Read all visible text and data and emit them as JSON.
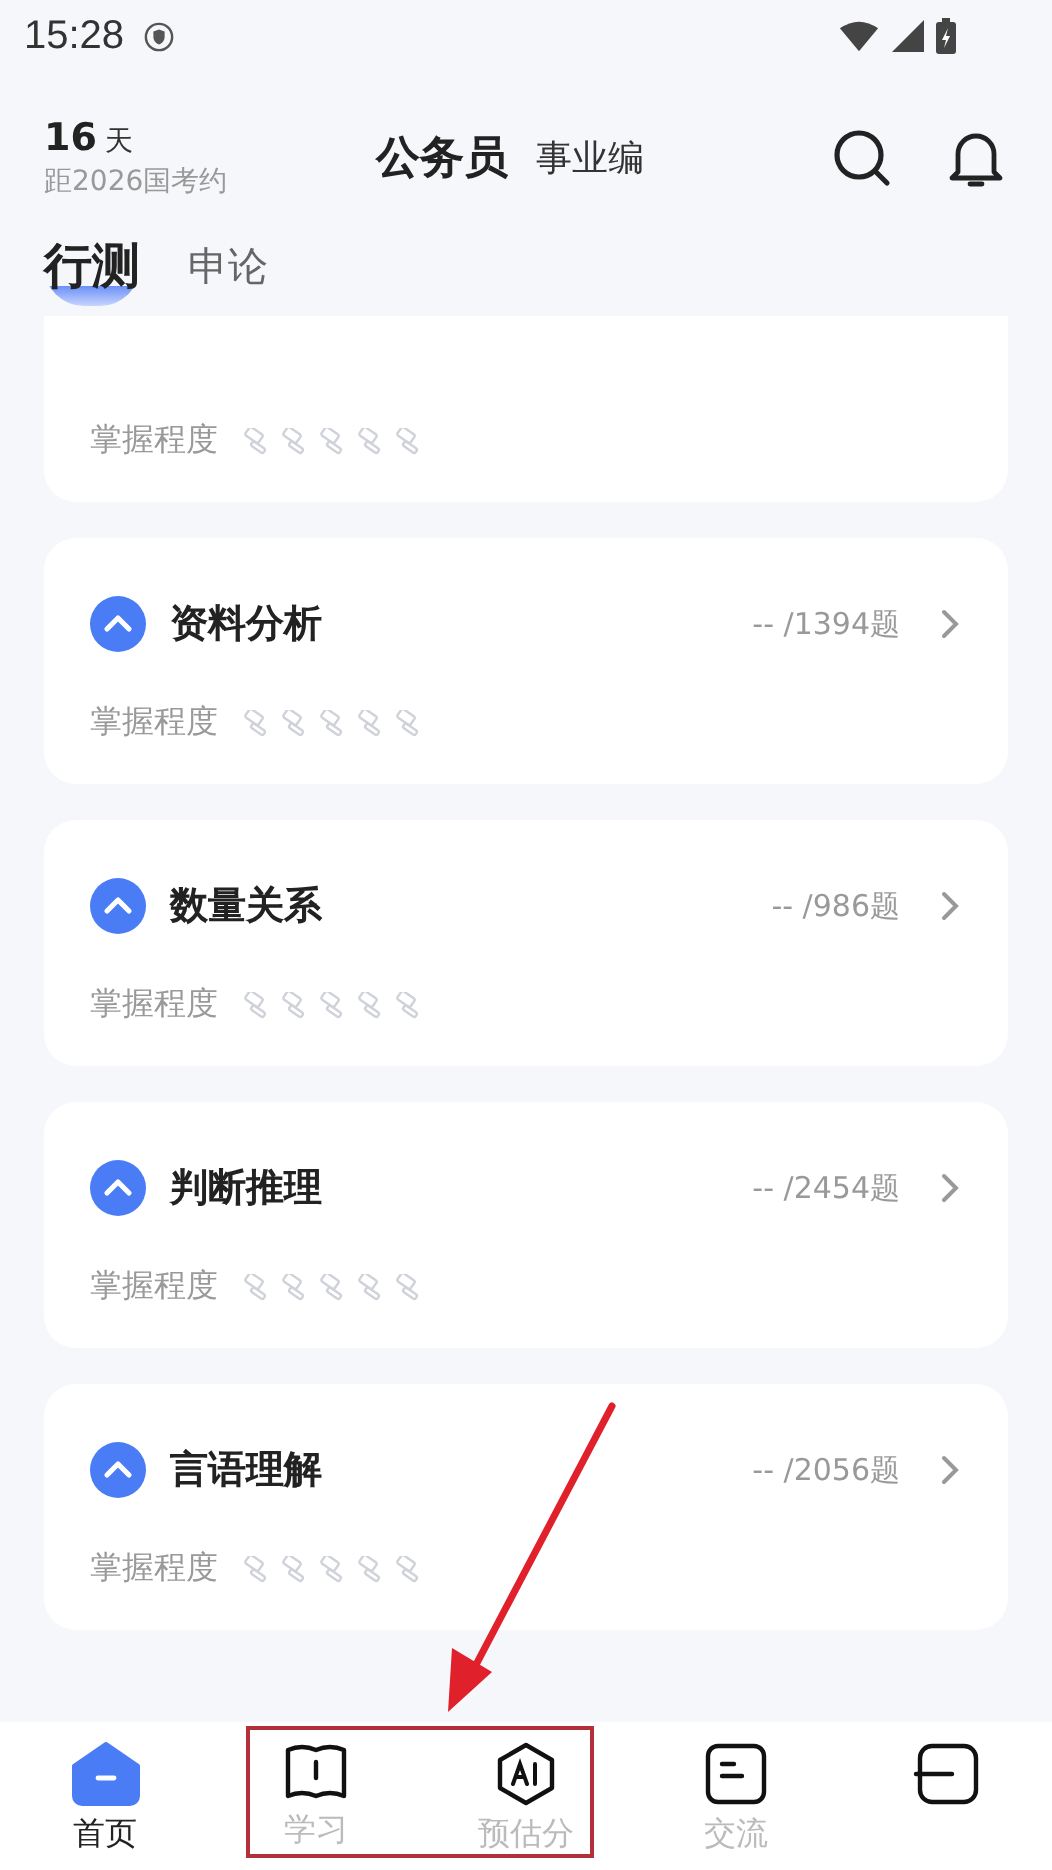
{
  "status_bar": {
    "time": "15:28"
  },
  "header": {
    "countdown_number": "16",
    "countdown_unit": "天",
    "countdown_caption": "距2026国考约",
    "title": "公务员",
    "subtitle": "事业编"
  },
  "tabs": [
    {
      "label": "行测",
      "selected": true
    },
    {
      "label": "申论",
      "selected": false
    }
  ],
  "partial_card": {
    "mastery_label": "掌握程度",
    "stars": 0
  },
  "subjects": [
    {
      "name": "资料分析",
      "progress": "-- /1394题",
      "mastery_label": "掌握程度",
      "stars": 0
    },
    {
      "name": "数量关系",
      "progress": "-- /986题",
      "mastery_label": "掌握程度",
      "stars": 0
    },
    {
      "name": "判断推理",
      "progress": "-- /2454题",
      "mastery_label": "掌握程度",
      "stars": 0
    },
    {
      "name": "言语理解",
      "progress": "-- /2056题",
      "mastery_label": "掌握程度",
      "stars": 0
    }
  ],
  "bottom_nav": [
    {
      "kind": "home",
      "label": "首页",
      "selected": true
    },
    {
      "kind": "book",
      "label": "学习",
      "selected": false
    },
    {
      "kind": "ai",
      "label": "预估分",
      "selected": false
    },
    {
      "kind": "chat",
      "label": "交流",
      "selected": false
    },
    {
      "kind": "profile",
      "selected": false
    }
  ]
}
